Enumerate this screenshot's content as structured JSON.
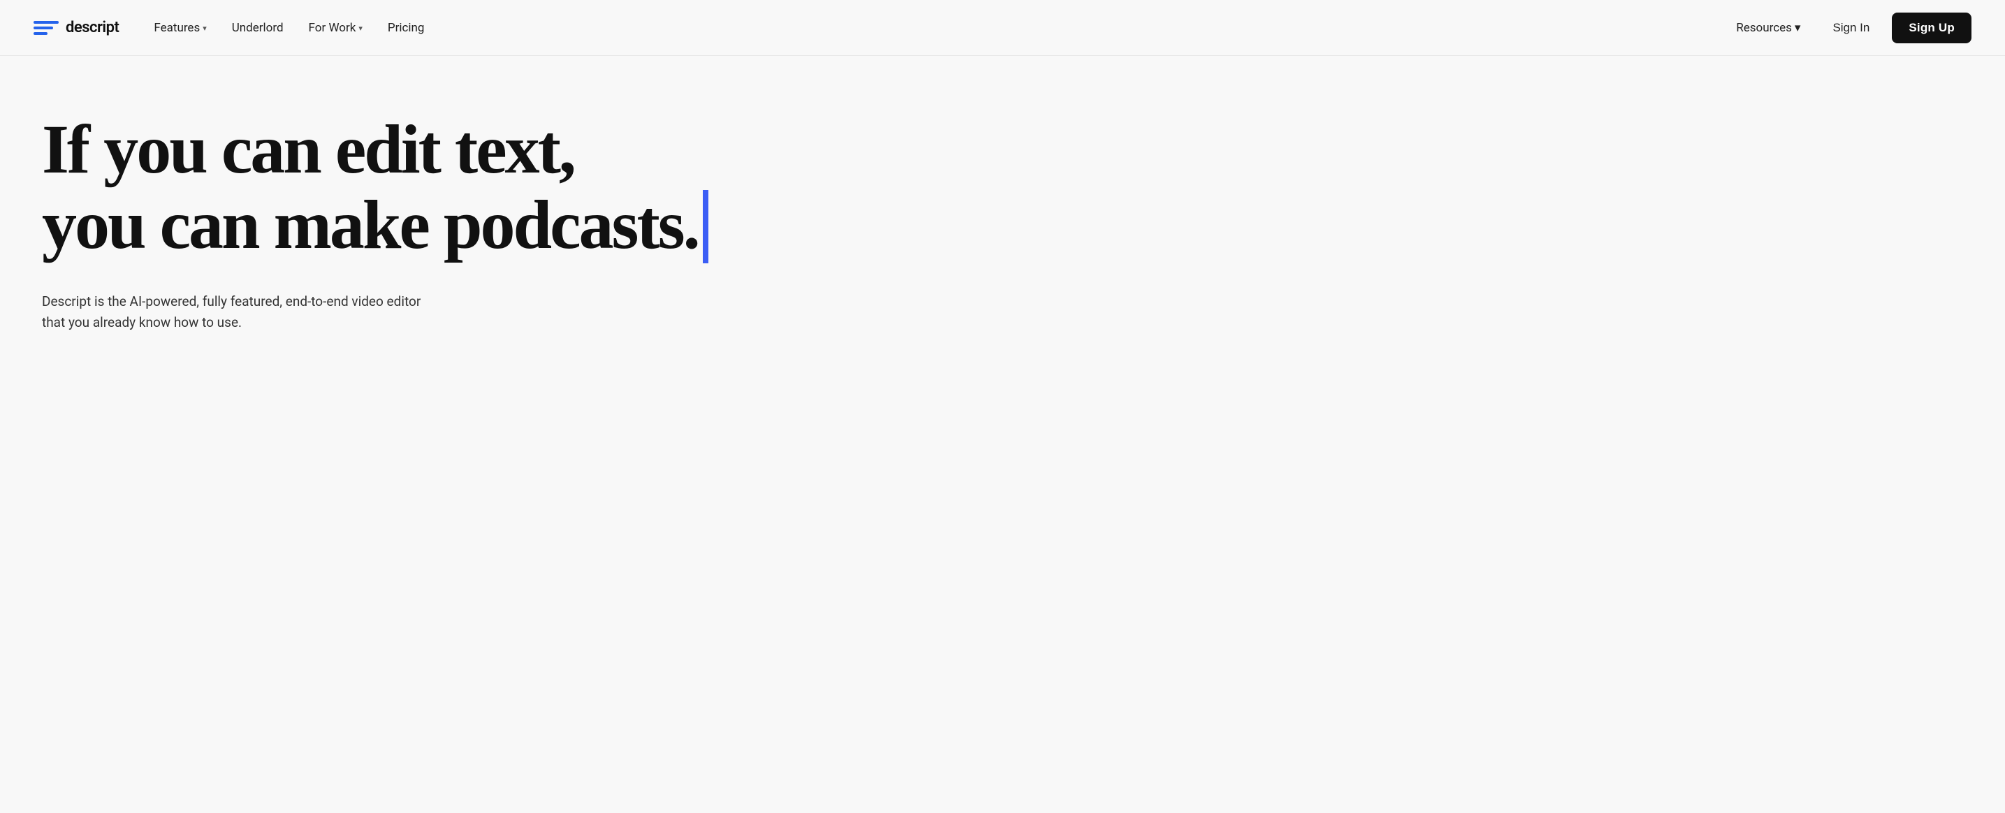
{
  "nav": {
    "logo_text": "descript",
    "links": [
      {
        "label": "Features",
        "has_dropdown": true
      },
      {
        "label": "Underlord",
        "has_dropdown": false
      },
      {
        "label": "For Work",
        "has_dropdown": true
      },
      {
        "label": "Pricing",
        "has_dropdown": false
      }
    ],
    "right": {
      "resources_label": "Resources",
      "sign_in_label": "Sign In",
      "sign_up_label": "Sign Up"
    }
  },
  "hero": {
    "headline_line1": "If you can edit text,",
    "headline_line2": "you can make podcasts.",
    "subtext_line1": "Descript is the AI-powered, fully featured, end-to-end video editor",
    "subtext_line2": "that you already know how to use."
  },
  "colors": {
    "accent_blue": "#3b5ef5",
    "logo_blue": "#2563eb",
    "text_dark": "#111111",
    "bg_light": "#f8f8f8"
  }
}
